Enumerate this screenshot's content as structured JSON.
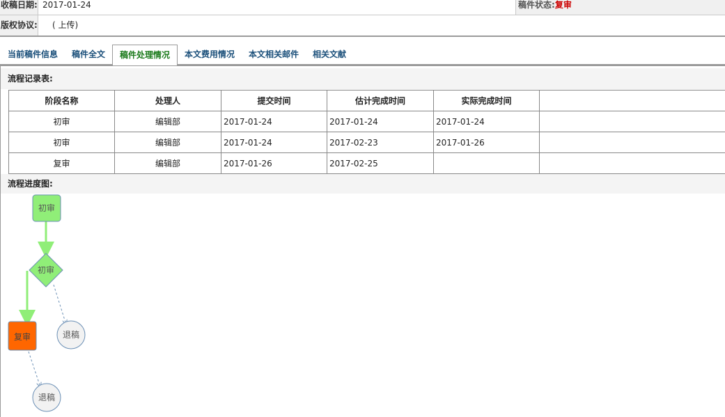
{
  "info": {
    "received_date_label": "收稿日期:",
    "received_date": "2017-01-24",
    "status_label": "稿件状态:",
    "status_value": "复审",
    "copyright_label": "版权协议:",
    "copyright_value": "( 上传)"
  },
  "tabs": [
    "当前稿件信息",
    "稿件全文",
    "稿件处理情况",
    "本文费用情况",
    "本文相关邮件",
    "相关文献"
  ],
  "active_tab": "稿件处理情况",
  "record_section_title": "流程记录表:",
  "record_table": {
    "headers": [
      "阶段名称",
      "处理人",
      "提交时间",
      "估计完成时间",
      "实际完成时间",
      ""
    ],
    "rows": [
      [
        "初审",
        "编辑部",
        "2017-01-24",
        "2017-01-24",
        "2017-01-24",
        ""
      ],
      [
        "初审",
        "编辑部",
        "2017-01-24",
        "2017-02-23",
        "2017-01-26",
        ""
      ],
      [
        "复审",
        "编辑部",
        "2017-01-26",
        "2017-02-25",
        "",
        ""
      ]
    ]
  },
  "progress_section_title": "流程进度图:",
  "flow": {
    "node_start": "初审",
    "node_decision": "初审",
    "node_current": "复审",
    "node_reject_1": "退稿",
    "node_reject_2": "退稿",
    "colors": {
      "done": "#90ee78",
      "current": "#ff6600",
      "reject": "#f2f2f2",
      "done_edge": "#90ee78",
      "dashed_edge": "#6a8fb5"
    }
  }
}
